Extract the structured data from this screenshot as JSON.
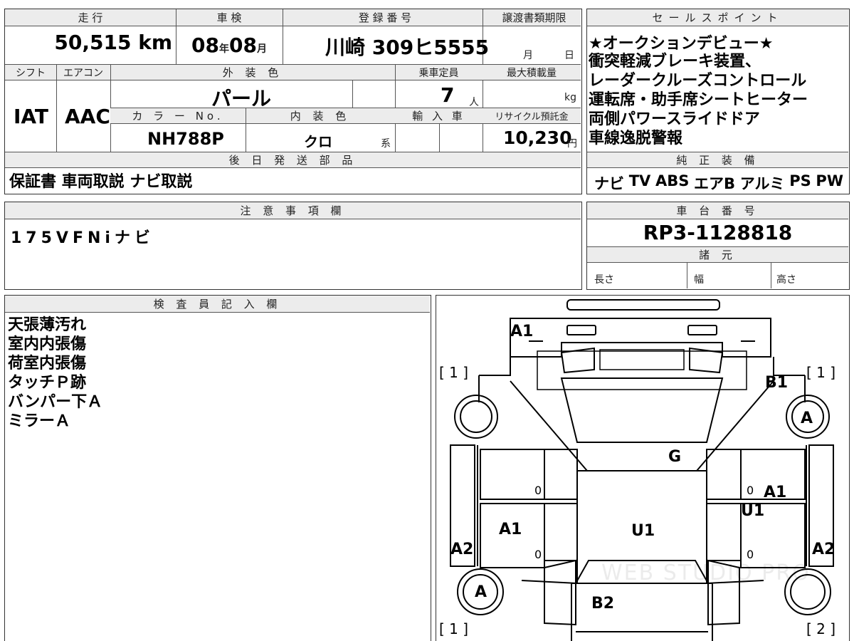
{
  "vehicle": {
    "mileage_label": "走 行",
    "mileage_value": "50,515",
    "mileage_unit": "km",
    "inspection_label": "車 検",
    "inspection_year": "08",
    "inspection_year_unit": "年",
    "inspection_month": "08",
    "inspection_month_unit": "月",
    "registration_label": "登 録 番 号",
    "registration_value": "川崎 309ヒ5555",
    "transfer_label": "譲渡書類期限",
    "transfer_month": "月",
    "transfer_day": "日",
    "shift_label": "シフト",
    "shift_value": "IAT",
    "ac_label": "エアコン",
    "ac_value": "AAC",
    "exterior_label": "外 装 色",
    "exterior_value": "パール",
    "capacity_label": "乗車定員",
    "capacity_value": "7",
    "capacity_unit": "人",
    "load_label": "最大積載量",
    "load_unit": "kg",
    "color_no_label": "カ ラ ー No.",
    "color_no_value": "NH788P",
    "interior_label": "内 装 色",
    "interior_value": "クロ",
    "interior_unit": "系",
    "import_label": "輸 入 車",
    "recycle_label": "リサイクル預託金",
    "recycle_value": "10,230",
    "recycle_unit": "円",
    "later_parts_label": "後 日 発 送 部 品",
    "later_parts_value": "保証書 車両取説 ナビ取説"
  },
  "sales_points": {
    "label": "セールスポイント",
    "lines": [
      "★オークションデビュー★",
      "衝突軽減ブレーキ装置、",
      "レーダークルーズコントロール",
      "運転席・助手席シートヒーター",
      "両側パワースライドドア",
      "車線逸脱警報"
    ]
  },
  "equipment": {
    "label": "純 正 装 備",
    "items": [
      "ナビ",
      "TV",
      "ABS",
      "エアB",
      "アルミ",
      "PS",
      "PW"
    ]
  },
  "notes": {
    "label": "注 意 事 項 欄",
    "value": "175VFNiナビ"
  },
  "chassis": {
    "label": "車 台 番 号",
    "value": "RP3-1128818",
    "specs_label": "諸 元",
    "length_label": "長さ",
    "width_label": "幅",
    "height_label": "高さ"
  },
  "inspector": {
    "label": "検 査 員 記 入 欄",
    "lines": [
      "天張薄汚れ",
      "室内内張傷",
      "荷室内張傷",
      "タッチＰ跡",
      "バンパー下Ａ",
      "ミラーＡ"
    ]
  },
  "diagram": {
    "marks": {
      "front_bumper": "A1",
      "bracket_tl": "[ 1 ]",
      "bracket_tr": "[ 1 ]",
      "bracket_bl": "[ 1 ]",
      "bracket_br": "[ 2 ]",
      "front_right_fender": "B1",
      "front_right_wheel": "A",
      "windshield": "G",
      "right_rear_door": "A1",
      "right_door_u": "U1",
      "left_front_door": "A1",
      "roof": "U1",
      "left_quarter": "A2",
      "right_quarter": "A2",
      "rear_left_wheel": "A",
      "rear_hatch": "B2",
      "zero_1": "0",
      "zero_2": "0",
      "zero_3": "0",
      "zero_4": "0"
    },
    "watermark": "WEB STUDIO PRO"
  }
}
